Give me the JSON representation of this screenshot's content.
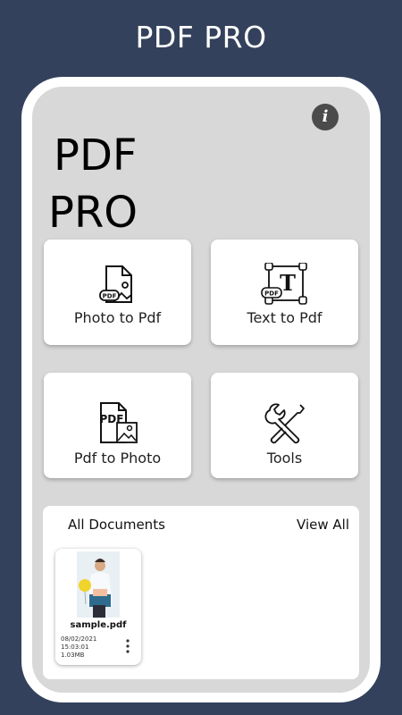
{
  "header": {
    "title": "PDF PRO"
  },
  "app": {
    "title_line1": "PDF",
    "title_line2": "PRO",
    "info_icon": "info-icon"
  },
  "actions": [
    {
      "label": "Photo to Pdf",
      "icon": "photo-pdf-icon"
    },
    {
      "label": "Text to Pdf",
      "icon": "text-pdf-icon"
    },
    {
      "label": "Pdf to Photo",
      "icon": "pdf-photo-icon"
    },
    {
      "label": "Tools",
      "icon": "tools-icon"
    }
  ],
  "documents": {
    "title": "All Documents",
    "view_all": "View All",
    "items": [
      {
        "name": "sample.pdf",
        "date": "08/02/2021",
        "time": "15:03:01",
        "size": "1.03MB"
      }
    ]
  },
  "colors": {
    "background": "#33415c",
    "screen": "#d8d8d8",
    "card": "#ffffff"
  }
}
